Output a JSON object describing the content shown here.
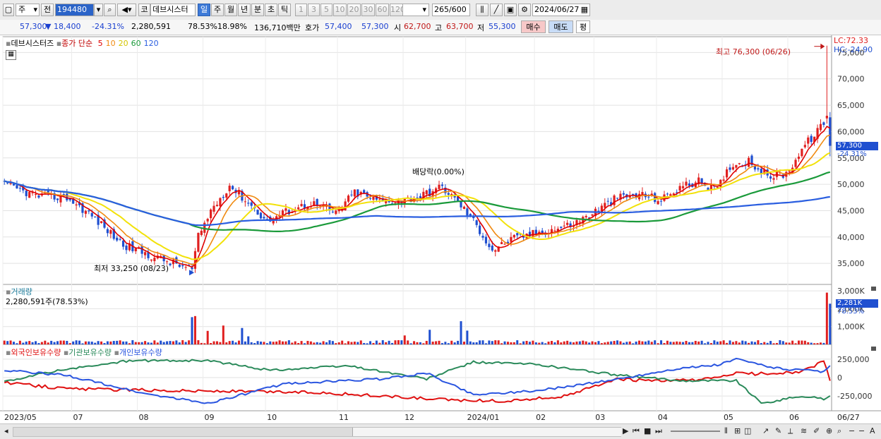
{
  "toolbar": {
    "market_type": "주",
    "prev_label": "전",
    "stock_code": "194480",
    "code_label": "코",
    "stock_name": "데브시스터",
    "periods": [
      "일",
      "주",
      "월",
      "년",
      "분",
      "초",
      "틱"
    ],
    "active_period": "일",
    "intervals": [
      "1",
      "3",
      "5",
      "10",
      "20",
      "30",
      "60",
      "120"
    ],
    "bar_count": "265",
    "bar_total": "/600",
    "date": "2024/06/27"
  },
  "quote_bar": {
    "price": "57,300",
    "change": "▼ 18,400",
    "change_pct": "-24.31%",
    "volume": "2,280,591",
    "volume_ratio": "78.53%",
    "turnover": "18.98%",
    "amount": "136,710백만",
    "ask_label": "호가",
    "ask": "57,400",
    "bid": "57,300",
    "open_label": "시",
    "open": "62,700",
    "high_label": "고",
    "high": "63,700",
    "low_label": "저",
    "low": "55,300",
    "buy_button": "매수",
    "sell_button": "매도",
    "avg_button": "평"
  },
  "price_panel": {
    "name": "데브시스터즈",
    "indicator": "종가 단순",
    "ma_labels": [
      "5",
      "10",
      "20",
      "60",
      "120"
    ],
    "lc": "LC:72.33",
    "hc": "HC:-24.90",
    "high_annotation": "최고 76,300 (06/26)",
    "low_annotation": "최저 33,250 (08/23)",
    "dividend_annotation": "배당락(0.00%)",
    "current_price_tag": "57,300",
    "current_pct_tag": "-24.31%",
    "y_axis": [
      "75,000",
      "70,000",
      "65,000",
      "60,000",
      "55,000",
      "50,000",
      "45,000",
      "40,000",
      "35,000"
    ]
  },
  "volume_panel": {
    "title": "거래량",
    "value": "2,280,591주(78.53%)",
    "y_axis": [
      "3,000K",
      "2,000K",
      "1,000K"
    ],
    "current_tag": "2,281K",
    "current_pct": "78.53%"
  },
  "holding_panel": {
    "series": [
      "외국인보유수량",
      "기관보유수량",
      "개인보유수량"
    ],
    "y_axis": [
      "250,000",
      "0",
      "-250,000"
    ]
  },
  "x_axis": [
    "2023/05",
    "07",
    "08",
    "09",
    "10",
    "11",
    "12",
    "2024/01",
    "02",
    "03",
    "04",
    "05",
    "06",
    "06/27"
  ],
  "colors": {
    "up": "#e02020",
    "down": "#1f4fd0",
    "ma5": "#e00000",
    "ma10": "#f08a10",
    "ma20": "#f2e20a",
    "ma60": "#1a9a3a",
    "ma120": "#2a5ee0",
    "foreign": "#e01010",
    "institution": "#2a8a5a",
    "individual": "#2a55e0"
  },
  "chart_data": {
    "type": "candlestick",
    "x_range": [
      "2023/05",
      "2024/06/27"
    ],
    "price_ylim": [
      31000,
      78000
    ],
    "close_path": {
      "dates": [
        "2023/05",
        "2023/06",
        "2023/07",
        "2023/08",
        "2023/08/23",
        "2023/09",
        "2023/10",
        "2023/11",
        "2023/12",
        "2024/01",
        "2024/02",
        "2024/03",
        "2024/04",
        "2024/05",
        "2024/06",
        "2024/06/26",
        "2024/06/27"
      ],
      "values": [
        50000,
        48000,
        47500,
        36000,
        33250,
        49000,
        44000,
        45000,
        47000,
        45000,
        38000,
        42000,
        47000,
        52000,
        53000,
        75700,
        57300
      ]
    },
    "last_bar": {
      "open": 62700,
      "high": 63700,
      "low": 55300,
      "close": 57300,
      "volume": 2280591
    },
    "volume_ylim": [
      0,
      3200000
    ],
    "holding_ylim": [
      -450000,
      450000
    ]
  }
}
